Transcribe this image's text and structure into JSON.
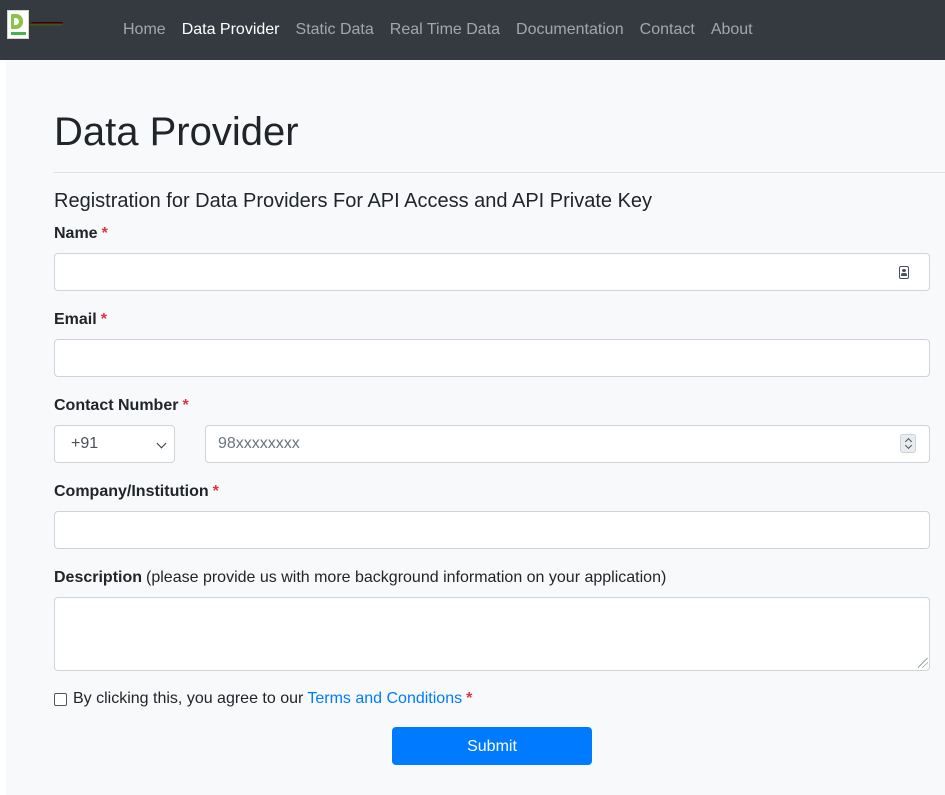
{
  "nav": {
    "links": [
      "Home",
      "Data Provider",
      "Static Data",
      "Real Time Data",
      "Documentation",
      "Contact",
      "About"
    ],
    "active": "Data Provider"
  },
  "page": {
    "title": "Data Provider",
    "subtitle": "Registration for Data Providers For API Access and API Private Key"
  },
  "form": {
    "name_label": "Name",
    "email_label": "Email",
    "contact_label": "Contact Number",
    "country_code": "+91",
    "phone_placeholder": "98xxxxxxxx",
    "company_label": "Company/Institution",
    "description_label": "Description",
    "description_hint": "(please provide us with more background information on your application)",
    "required_mark": "*",
    "agree_text": "By clicking this, you agree to our",
    "terms_link": "Terms and Conditions",
    "submit_label": "Submit"
  },
  "colors": {
    "navbar": "#343a40",
    "content_bg": "#f8f9fa",
    "primary": "#007bff",
    "required": "#dc3545"
  },
  "icons": [
    "logo-icon",
    "contact-card-icon",
    "chevron-down-icon",
    "number-spinner-icon",
    "resize-handle-icon"
  ]
}
